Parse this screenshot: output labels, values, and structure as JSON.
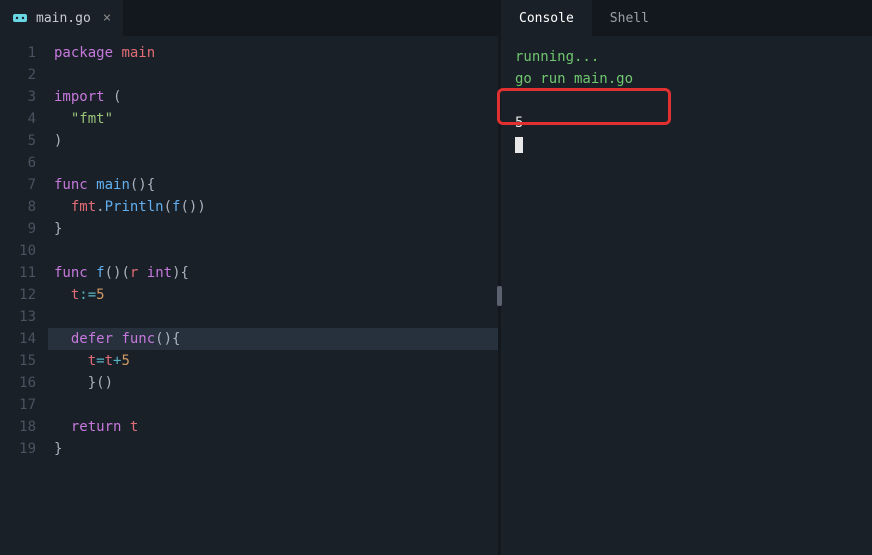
{
  "editor": {
    "tab": {
      "filename": "main.go",
      "icon": "go-icon"
    },
    "code": {
      "lines": [
        [
          {
            "c": "kw",
            "t": "package"
          },
          {
            "c": "punct",
            "t": " "
          },
          {
            "c": "name",
            "t": "main"
          }
        ],
        [],
        [
          {
            "c": "kw",
            "t": "import"
          },
          {
            "c": "punct",
            "t": " ("
          }
        ],
        [
          {
            "c": "punct",
            "t": "  "
          },
          {
            "c": "str",
            "t": "\"fmt\""
          }
        ],
        [
          {
            "c": "punct",
            "t": ")"
          }
        ],
        [],
        [
          {
            "c": "kw",
            "t": "func"
          },
          {
            "c": "punct",
            "t": " "
          },
          {
            "c": "fn",
            "t": "main"
          },
          {
            "c": "punct",
            "t": "(){"
          }
        ],
        [
          {
            "c": "punct",
            "t": "  "
          },
          {
            "c": "name",
            "t": "fmt"
          },
          {
            "c": "punct",
            "t": "."
          },
          {
            "c": "fn",
            "t": "Println"
          },
          {
            "c": "punct",
            "t": "("
          },
          {
            "c": "fn",
            "t": "f"
          },
          {
            "c": "punct",
            "t": "())"
          }
        ],
        [
          {
            "c": "punct",
            "t": "}"
          }
        ],
        [],
        [
          {
            "c": "kw",
            "t": "func"
          },
          {
            "c": "punct",
            "t": " "
          },
          {
            "c": "fn",
            "t": "f"
          },
          {
            "c": "punct",
            "t": "()("
          },
          {
            "c": "name",
            "t": "r"
          },
          {
            "c": "punct",
            "t": " "
          },
          {
            "c": "kw",
            "t": "int"
          },
          {
            "c": "punct",
            "t": "){"
          }
        ],
        [
          {
            "c": "punct",
            "t": "  "
          },
          {
            "c": "name",
            "t": "t"
          },
          {
            "c": "op",
            "t": ":="
          },
          {
            "c": "lit",
            "t": "5"
          }
        ],
        [],
        [
          {
            "c": "punct",
            "t": "  "
          },
          {
            "c": "kw",
            "t": "defer"
          },
          {
            "c": "punct",
            "t": " "
          },
          {
            "c": "kw",
            "t": "func"
          },
          {
            "c": "punct",
            "t": "(){"
          }
        ],
        [
          {
            "c": "punct",
            "t": "    "
          },
          {
            "c": "name",
            "t": "t"
          },
          {
            "c": "op",
            "t": "="
          },
          {
            "c": "name",
            "t": "t"
          },
          {
            "c": "op",
            "t": "+"
          },
          {
            "c": "lit",
            "t": "5"
          }
        ],
        [
          {
            "c": "punct",
            "t": "    }()"
          }
        ],
        [],
        [
          {
            "c": "punct",
            "t": "  "
          },
          {
            "c": "kw",
            "t": "return"
          },
          {
            "c": "punct",
            "t": " "
          },
          {
            "c": "name",
            "t": "t"
          }
        ],
        [
          {
            "c": "punct",
            "t": "}"
          }
        ]
      ],
      "highlightedLine": 14
    }
  },
  "output": {
    "tabs": [
      {
        "label": "Console",
        "active": true
      },
      {
        "label": "Shell",
        "active": false
      }
    ],
    "lines": [
      {
        "text": "running...",
        "class": "green"
      },
      {
        "text": "go run main.go",
        "class": "green"
      },
      {
        "text": "",
        "class": ""
      },
      {
        "text": "5",
        "class": "white"
      }
    ]
  }
}
